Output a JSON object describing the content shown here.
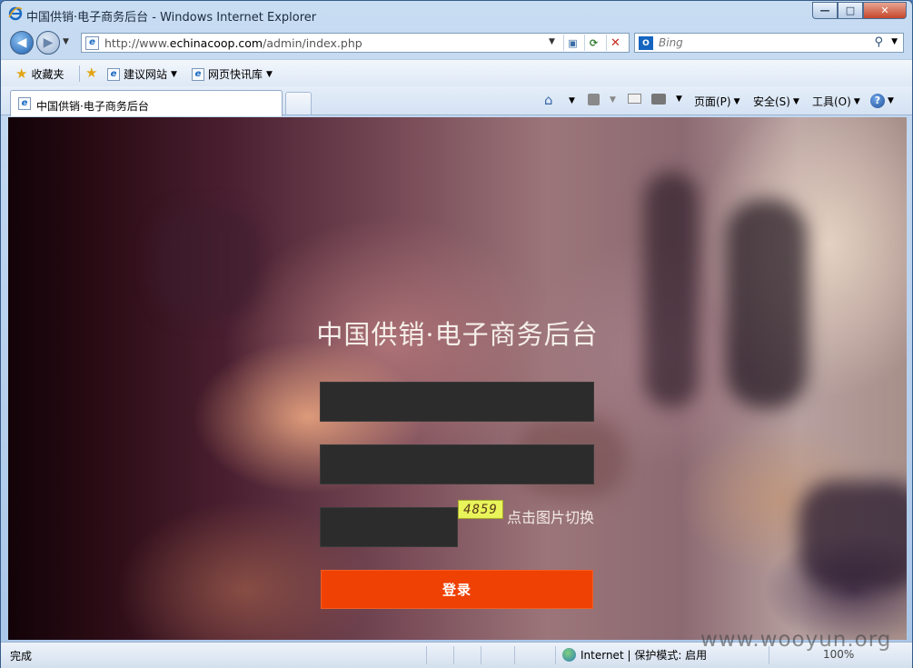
{
  "window": {
    "title": "中国供销·电子商务后台 - Windows Internet Explorer",
    "controls": {
      "minimize": "—",
      "maximize": "□",
      "close": "✕"
    }
  },
  "nav": {
    "url_prefix": "http://www.",
    "url_domain": "echinacoop.com",
    "url_path": "/admin/index.php",
    "search_provider": "Bing"
  },
  "favorites_bar": {
    "favorites_label": "收藏夹",
    "items": [
      {
        "label": "建议网站"
      },
      {
        "label": "网页快讯库"
      }
    ]
  },
  "tabs": [
    {
      "label": "中国供销·电子商务后台",
      "active": true
    }
  ],
  "command_bar": {
    "page_menu": "页面(P)",
    "safety_menu": "安全(S)",
    "tools_menu": "工具(O)"
  },
  "page": {
    "title": "中国供销·电子商务后台",
    "username_value": "",
    "password_value": "",
    "captcha_input_value": "",
    "captcha_image_text": "4859",
    "captcha_tip": "点击图片切换",
    "login_button": "登录"
  },
  "status_bar": {
    "status": "完成",
    "zone": "Internet | 保护模式: 启用",
    "zoom": "100%"
  },
  "watermark": "www.wooyun.org",
  "colors": {
    "login_button": "#ef4103",
    "input_background": "#2c2c2c",
    "captcha_background": "#e8f45a"
  }
}
